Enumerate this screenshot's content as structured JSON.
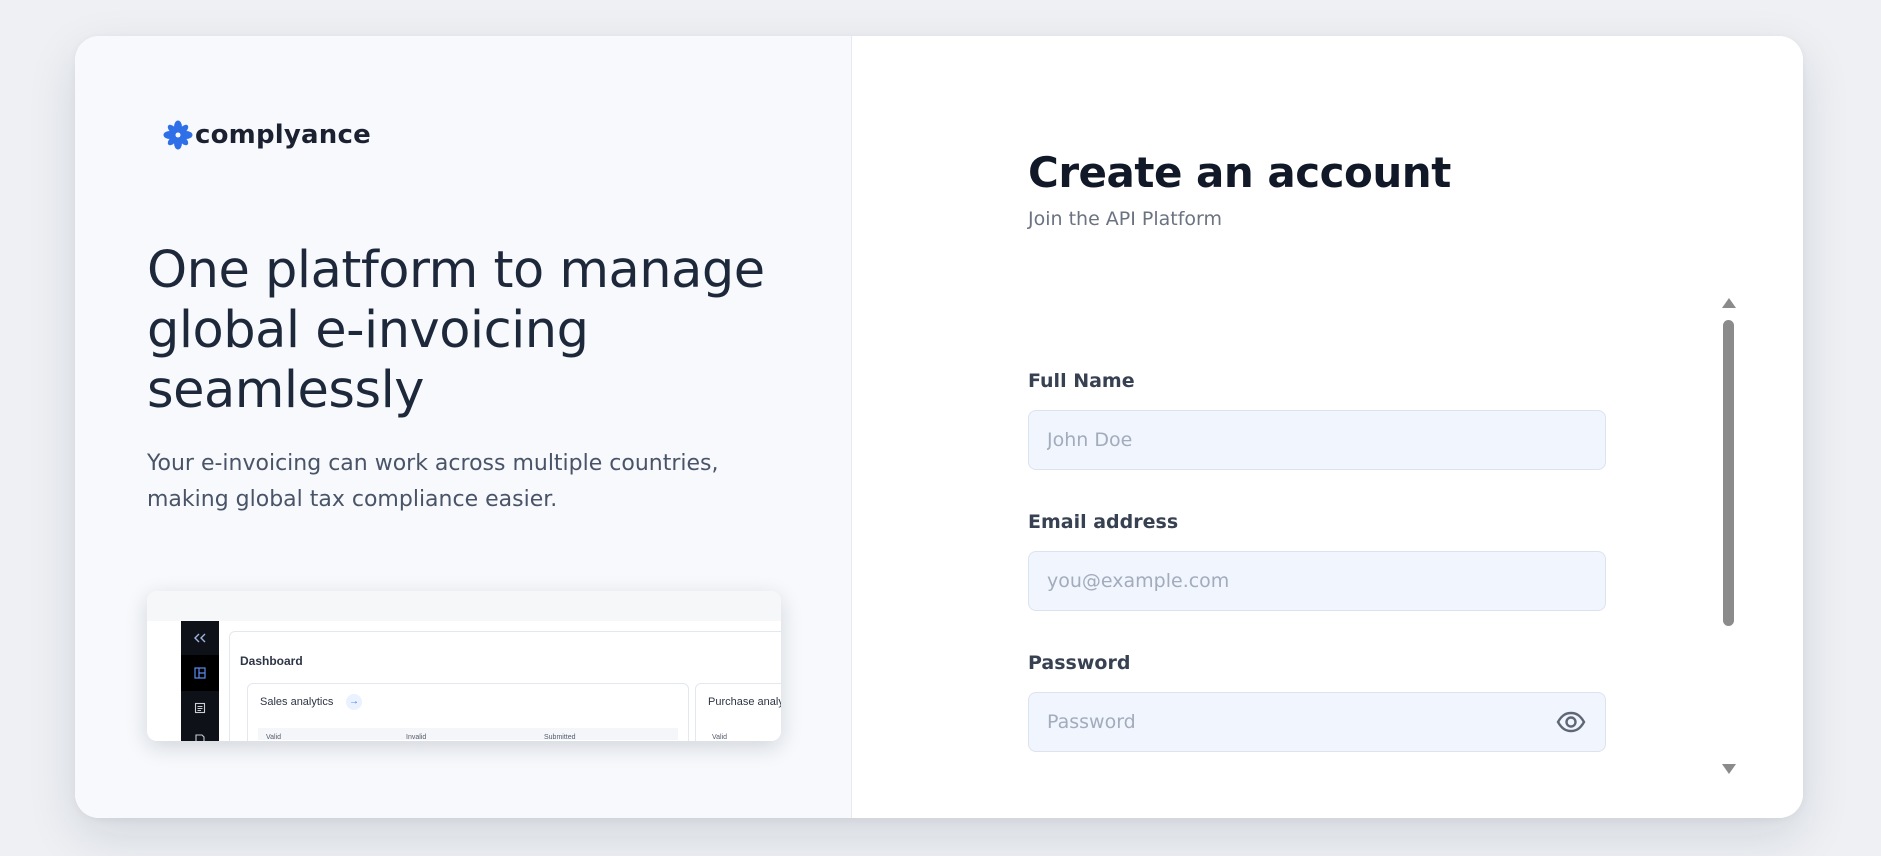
{
  "brand": {
    "name": "complyance",
    "accent_color": "#2f6fe8",
    "logo_icon": "flower-logo-icon"
  },
  "hero": {
    "headline": "One platform to manage global e-invoicing seamlessly",
    "subtext": "Your e-invoicing can work across multiple countries, making global tax compliance easier."
  },
  "preview": {
    "title": "Dashboard",
    "cards": [
      {
        "title": "Sales analytics",
        "columns": [
          "Valid",
          "Invalid",
          "Submitted"
        ]
      },
      {
        "title": "Purchase analy",
        "columns": [
          "Valid"
        ]
      }
    ]
  },
  "form": {
    "title": "Create an account",
    "subtitle": "Join the API Platform",
    "fields": {
      "full_name": {
        "label": "Full Name",
        "placeholder": "John Doe",
        "value": ""
      },
      "email": {
        "label": "Email address",
        "placeholder": "you@example.com",
        "value": ""
      },
      "password": {
        "label": "Password",
        "placeholder": "Password",
        "value": ""
      }
    }
  }
}
